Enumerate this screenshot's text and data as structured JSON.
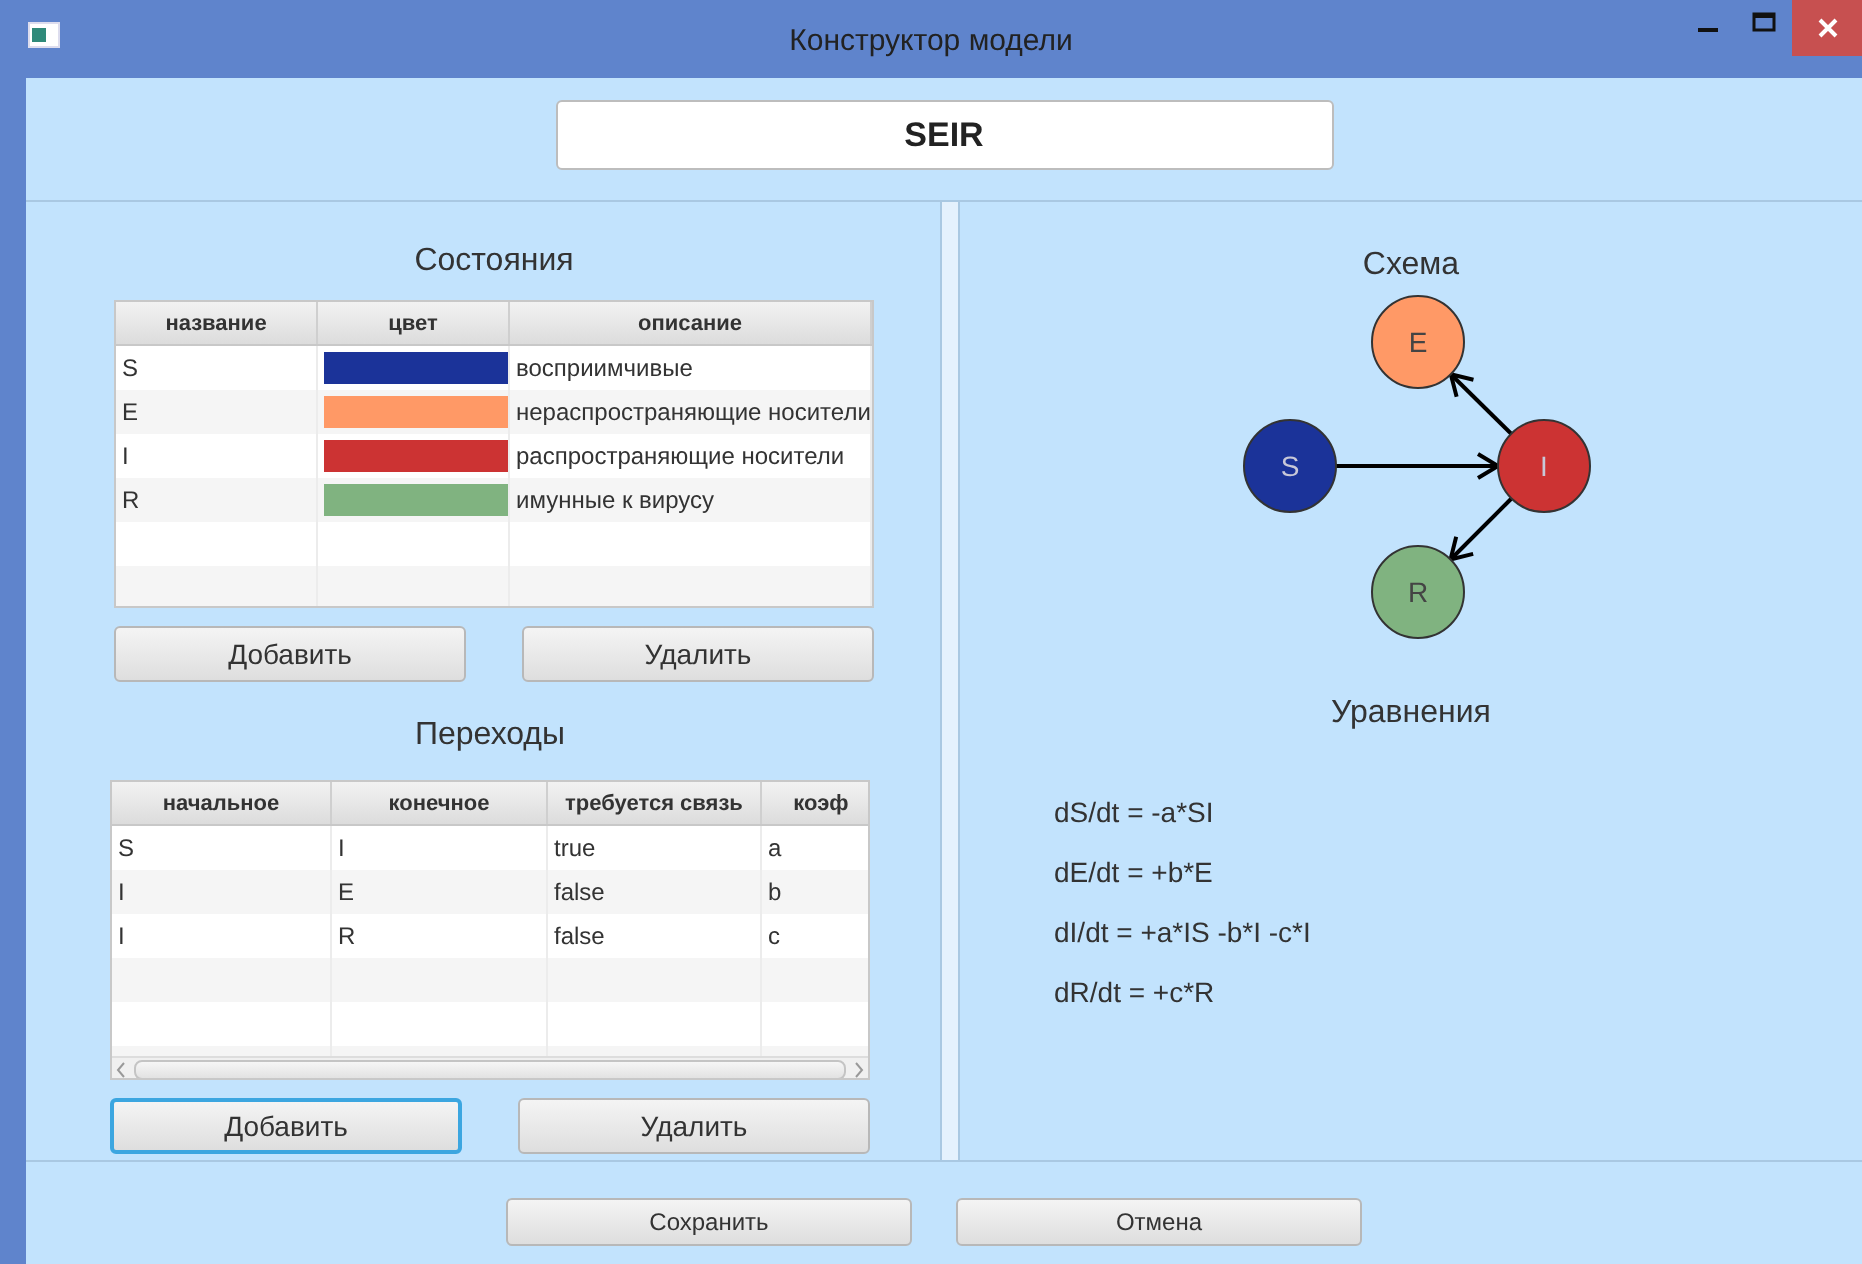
{
  "window": {
    "title": "Конструктор модели"
  },
  "model_name": {
    "value": "SEIR"
  },
  "states": {
    "title": "Состояния",
    "columns": [
      "название",
      "цвет",
      "описание"
    ],
    "rows": [
      {
        "name": "S",
        "color": "#1b3399",
        "description": "восприимчивые"
      },
      {
        "name": "E",
        "color": "#ff9966",
        "description": "нераспространяющие носители"
      },
      {
        "name": "I",
        "color": "#cc3333",
        "description": "распространяющие носители"
      },
      {
        "name": "R",
        "color": "#80b380",
        "description": "имунные к вирусу"
      }
    ],
    "buttons": [
      {
        "label": "Добавить",
        "focused": false
      },
      {
        "label": "Удалить",
        "focused": false
      }
    ]
  },
  "transitions": {
    "title": "Переходы",
    "columns": [
      "начальное",
      "конечное",
      "требуется связь",
      "коэф"
    ],
    "rows": [
      [
        "S",
        "I",
        "true",
        "a"
      ],
      [
        "I",
        "E",
        "false",
        "b"
      ],
      [
        "I",
        "R",
        "false",
        "c"
      ]
    ],
    "buttons": [
      {
        "label": "Добавить",
        "focused": true
      },
      {
        "label": "Удалить",
        "focused": false
      }
    ]
  },
  "scheme": {
    "title": "Схема",
    "nodes": [
      {
        "label": "S",
        "color": "#1b3399"
      },
      {
        "label": "E",
        "color": "#ff9966"
      },
      {
        "label": "I",
        "color": "#cc3333"
      },
      {
        "label": "R",
        "color": "#80b380"
      }
    ]
  },
  "equations": {
    "title": "Уравнения",
    "lines": [
      "dS/dt = -a*SI",
      "dE/dt = +b*E",
      "dI/dt = +a*IS -b*I -c*I",
      "dR/dt = +c*R"
    ]
  },
  "footer": {
    "buttons": [
      "Сохранить",
      "Отмена"
    ]
  }
}
